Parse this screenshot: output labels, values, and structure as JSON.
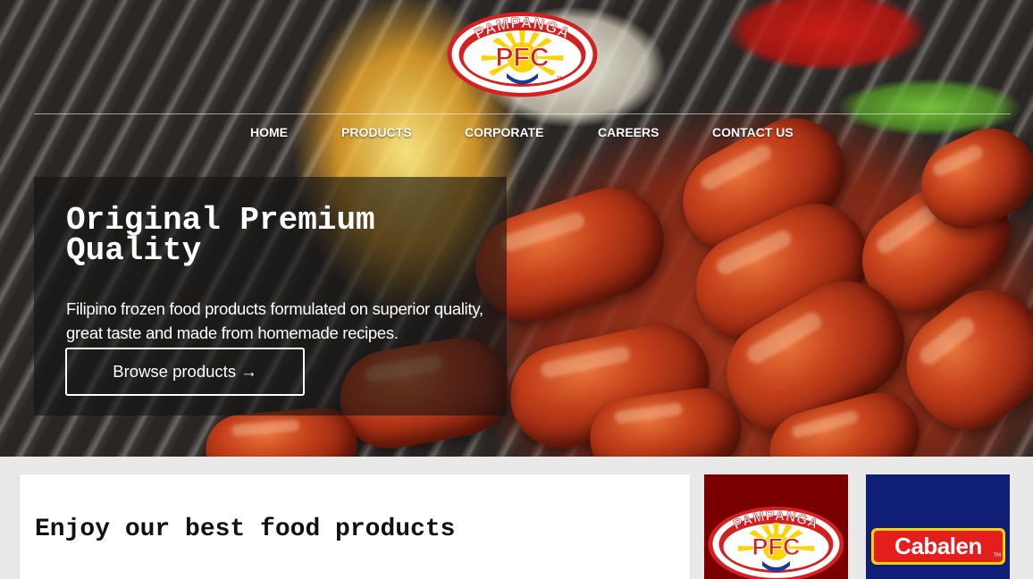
{
  "brand": {
    "name": "PAMPANGA",
    "mark": "PFC",
    "trademark": "TM"
  },
  "nav": {
    "items": [
      {
        "label": "HOME"
      },
      {
        "label": "PRODUCTS"
      },
      {
        "label": "CORPORATE"
      },
      {
        "label": "CAREERS"
      },
      {
        "label": "CONTACT US"
      }
    ]
  },
  "hero": {
    "title": "Original Premium Quality",
    "subtitle": "Filipino frozen food products formulated on superior quality, great taste and made from homemade recipes.",
    "cta_label": "Browse products →"
  },
  "section": {
    "title": "Enjoy our best food products"
  },
  "brands": [
    {
      "name": "PAMPANGA",
      "mark": "PFC",
      "bg": "#7a0000"
    },
    {
      "name": "Cabalen",
      "bg": "#0f1f78"
    }
  ],
  "colors": {
    "logo_red": "#d42020",
    "logo_yellow": "#ffd200",
    "logo_blue": "#1a3a9a",
    "white": "#ffffff"
  }
}
